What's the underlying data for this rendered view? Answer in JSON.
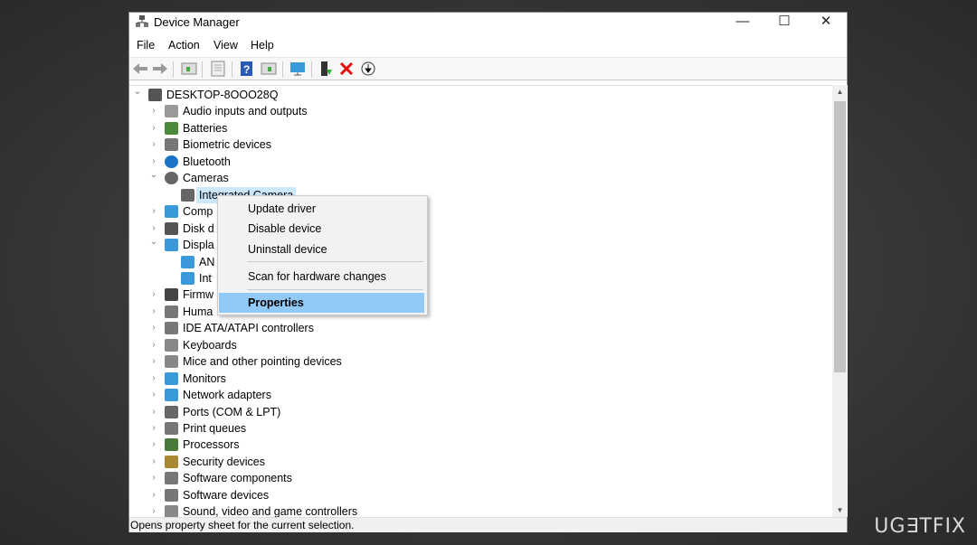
{
  "window": {
    "title": "Device Manager",
    "minimize": "—",
    "maximize": "☐",
    "close": "✕"
  },
  "menubar": [
    "File",
    "Action",
    "View",
    "Help"
  ],
  "toolbar_icons": [
    "back-icon",
    "forward-icon",
    "show-hide-console-tree-icon",
    "properties-icon",
    "help-icon",
    "action-pane-icon",
    "monitor-icon",
    "update-driver-icon",
    "uninstall-icon",
    "disable-icon"
  ],
  "tree": [
    {
      "label": "DESKTOP-8OOO28Q",
      "level": 0,
      "state": "expanded",
      "icon": "computer-icon",
      "color": "#555555"
    },
    {
      "label": "Audio inputs and outputs",
      "level": 1,
      "state": "collapsed",
      "icon": "speaker-icon",
      "color": "#999999"
    },
    {
      "label": "Batteries",
      "level": 1,
      "state": "collapsed",
      "icon": "battery-icon",
      "color": "#4a8a3a"
    },
    {
      "label": "Biometric devices",
      "level": 1,
      "state": "collapsed",
      "icon": "fingerprint-icon",
      "color": "#777777"
    },
    {
      "label": "Bluetooth",
      "level": 1,
      "state": "collapsed",
      "icon": "bluetooth-icon",
      "color": "#1a73c8"
    },
    {
      "label": "Cameras",
      "level": 1,
      "state": "expanded",
      "icon": "camera-icon",
      "color": "#666666"
    },
    {
      "label": "Integrated Camera",
      "level": 2,
      "state": "selected",
      "icon": "webcam-icon",
      "color": "#666666"
    },
    {
      "label": "Comp",
      "level": 1,
      "state": "collapsed",
      "icon": "monitor-icon",
      "color": "#3a9ad9"
    },
    {
      "label": "Disk d",
      "level": 1,
      "state": "collapsed",
      "icon": "disk-icon",
      "color": "#555555"
    },
    {
      "label": "Displa",
      "level": 1,
      "state": "expanded",
      "icon": "display-adapter-icon",
      "color": "#3a9ad9"
    },
    {
      "label": "AN",
      "level": 2,
      "state": "leaf",
      "icon": "display-adapter-icon",
      "color": "#3a9ad9"
    },
    {
      "label": "Int",
      "level": 2,
      "state": "leaf",
      "icon": "display-adapter-icon",
      "color": "#3a9ad9"
    },
    {
      "label": "Firmw",
      "level": 1,
      "state": "collapsed",
      "icon": "firmware-icon",
      "color": "#444444"
    },
    {
      "label": "Huma",
      "level": 1,
      "state": "collapsed",
      "icon": "hid-icon",
      "color": "#777777"
    },
    {
      "label": "IDE ATA/ATAPI controllers",
      "level": 1,
      "state": "collapsed",
      "icon": "ide-icon",
      "color": "#777777"
    },
    {
      "label": "Keyboards",
      "level": 1,
      "state": "collapsed",
      "icon": "keyboard-icon",
      "color": "#888888"
    },
    {
      "label": "Mice and other pointing devices",
      "level": 1,
      "state": "collapsed",
      "icon": "mouse-icon",
      "color": "#888888"
    },
    {
      "label": "Monitors",
      "level": 1,
      "state": "collapsed",
      "icon": "monitor-icon",
      "color": "#3a9ad9"
    },
    {
      "label": "Network adapters",
      "level": 1,
      "state": "collapsed",
      "icon": "network-icon",
      "color": "#3a9ad9"
    },
    {
      "label": "Ports (COM & LPT)",
      "level": 1,
      "state": "collapsed",
      "icon": "port-icon",
      "color": "#666666"
    },
    {
      "label": "Print queues",
      "level": 1,
      "state": "collapsed",
      "icon": "printer-icon",
      "color": "#777777"
    },
    {
      "label": "Processors",
      "level": 1,
      "state": "collapsed",
      "icon": "processor-icon",
      "color": "#4a7a3a"
    },
    {
      "label": "Security devices",
      "level": 1,
      "state": "collapsed",
      "icon": "security-icon",
      "color": "#aa8833"
    },
    {
      "label": "Software components",
      "level": 1,
      "state": "collapsed",
      "icon": "software-component-icon",
      "color": "#777777"
    },
    {
      "label": "Software devices",
      "level": 1,
      "state": "collapsed",
      "icon": "software-device-icon",
      "color": "#777777"
    },
    {
      "label": "Sound, video and game controllers",
      "level": 1,
      "state": "collapsed",
      "icon": "sound-icon",
      "color": "#888888"
    }
  ],
  "context_menu": {
    "items": [
      "Update driver",
      "Disable device",
      "Uninstall device",
      "Scan for hardware changes",
      "Properties"
    ],
    "highlighted": "Properties"
  },
  "status_bar": "Opens property sheet for the current selection.",
  "watermark": "UG∃TFIX"
}
